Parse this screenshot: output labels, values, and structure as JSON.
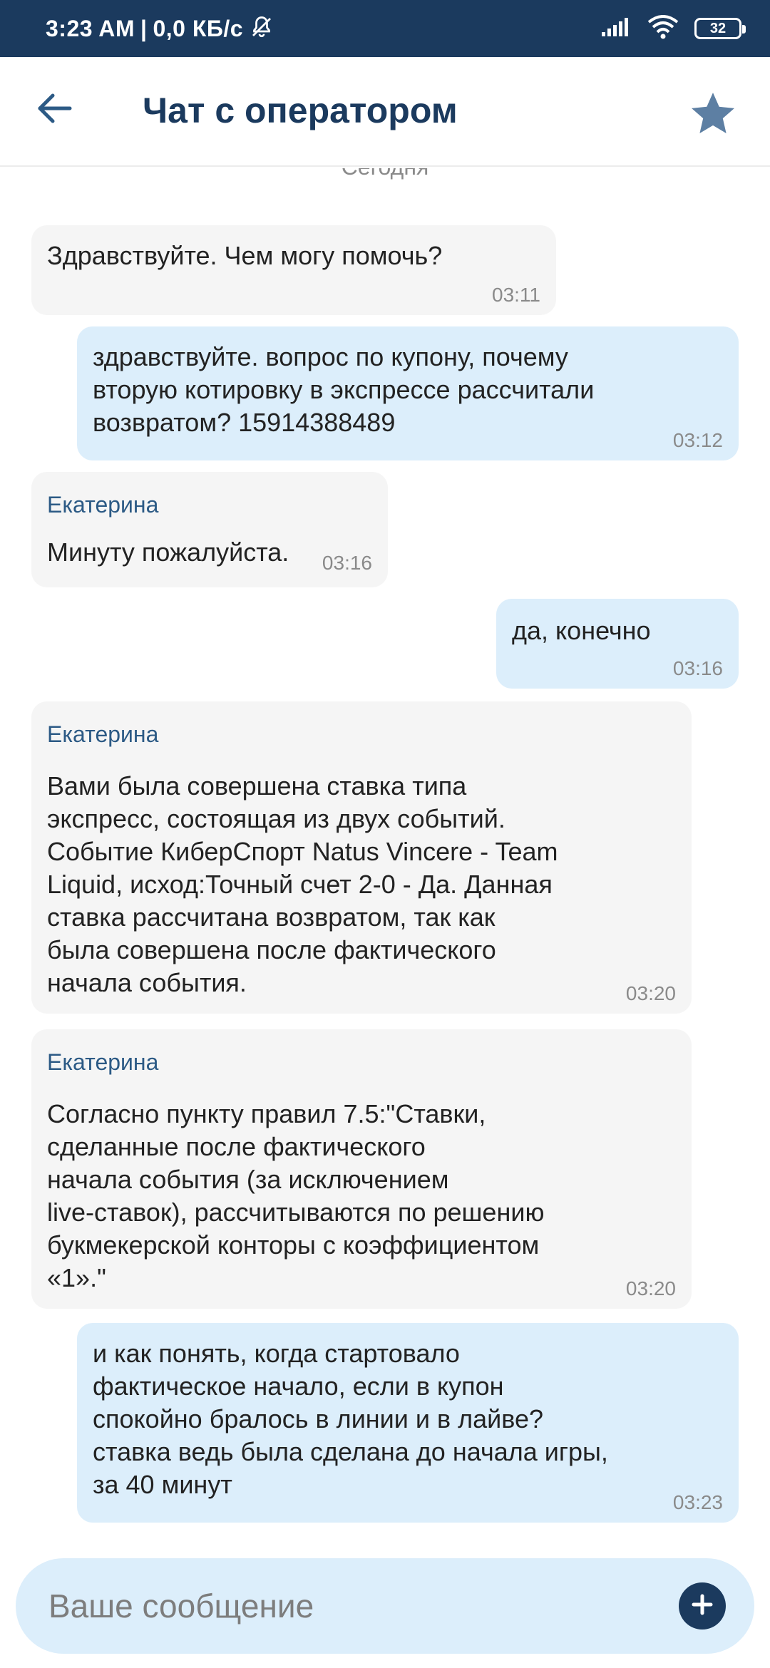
{
  "status_bar": {
    "time": "3:23 AM",
    "separator": "|",
    "network_speed": "0,0 КБ/с",
    "battery_level": "32",
    "icons": [
      "dnd-off-icon",
      "signal-icon",
      "wifi-icon",
      "battery-icon"
    ]
  },
  "header": {
    "title": "Чат с оператором",
    "back_icon": "arrow-left-icon",
    "favorite_icon": "star-icon"
  },
  "chat": {
    "date_label": "Сегодня",
    "messages": [
      {
        "direction": "incoming",
        "sender": "",
        "text": "Здравствуйте. Чем могу помочь?",
        "time": "03:11"
      },
      {
        "direction": "outgoing",
        "sender": "",
        "text": "здравствуйте. вопрос по купону, почему\nвторую котировку в экспрессе рассчитали\nвозвратом? 15914388489",
        "time": "03:12"
      },
      {
        "direction": "incoming",
        "sender": "Екатерина",
        "text": "Минуту пожалуйста.",
        "time": "03:16"
      },
      {
        "direction": "outgoing",
        "sender": "",
        "text": "да, конечно",
        "time": "03:16"
      },
      {
        "direction": "incoming",
        "sender": "Екатерина",
        "text": "Вами была совершена ставка типа\nэкспресс, состоящая из двух событий.\nСобытие КиберСпорт Natus Vincere - Team\nLiquid, исход:Точный счет 2-0 - Да. Данная\nставка рассчитана возвратом, так как\nбыла совершена после фактического\nначала события.",
        "time": "03:20"
      },
      {
        "direction": "incoming",
        "sender": "Екатерина",
        "text": "Согласно пункту правил 7.5:\"Ставки,\nсделанные после фактического\nначала события (за исключением\nlive-ставок), рассчитываются по решению\nбукмекерской конторы с коэффициентом\n«1».\"",
        "time": "03:20"
      },
      {
        "direction": "outgoing",
        "sender": "",
        "text": "и как понять, когда стартовало\nфактическое начало, если в купон\nспокойно бралось в линии и в лайве?\nставка ведь была сделана до начала игры,\nза 40 минут",
        "time": "03:23"
      }
    ]
  },
  "composer": {
    "placeholder": "Ваше сообщение",
    "value": "",
    "add_icon": "plus-circle-icon"
  },
  "colors": {
    "status_bar_bg": "#1b3a5e",
    "title": "#1b3a5e",
    "incoming_bubble": "#f5f5f5",
    "outgoing_bubble": "#dceefb",
    "sender_name": "#2c5a85",
    "time": "#8a8a8a",
    "star": "#5d7fa3"
  }
}
